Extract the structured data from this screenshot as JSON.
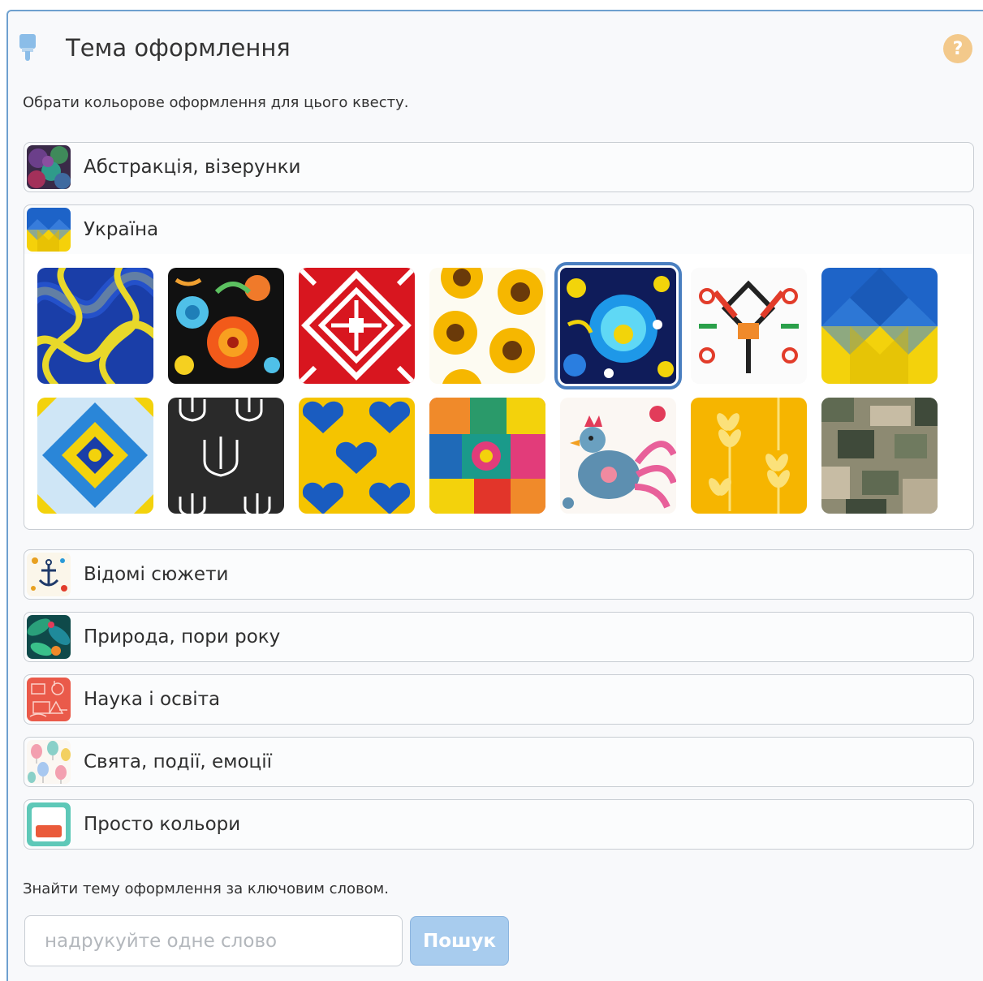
{
  "header": {
    "title": "Тема оформлення",
    "help_icon": "question-icon",
    "help_symbol": "?",
    "brush_icon": "paintbrush-icon"
  },
  "subtitle": "Обрати кольорове оформлення для цього квесту.",
  "categories": [
    {
      "label": "Абстракція, візерунки",
      "icon": "abstract-bokeh-thumb",
      "expanded": false
    },
    {
      "label": "Україна",
      "icon": "ukraine-flag-thumb",
      "expanded": true
    },
    {
      "label": "Відомі сюжети",
      "icon": "anchor-pattern-thumb",
      "expanded": false
    },
    {
      "label": "Природа, пори року",
      "icon": "tropical-leaves-thumb",
      "expanded": false
    },
    {
      "label": "Наука і освіта",
      "icon": "science-doodle-thumb",
      "expanded": false
    },
    {
      "label": "Свята, події, емоції",
      "icon": "balloons-thumb",
      "expanded": false
    },
    {
      "label": "Просто кольори",
      "icon": "plain-color-thumb",
      "expanded": false
    }
  ],
  "ukraine_themes": [
    {
      "name": "blue-yellow-waves",
      "selected": false
    },
    {
      "name": "petrykivka-flowers",
      "selected": false
    },
    {
      "name": "red-embroidery",
      "selected": false
    },
    {
      "name": "sunflowers",
      "selected": false
    },
    {
      "name": "blue-flower-folk",
      "selected": true
    },
    {
      "name": "cross-stitch-ornament",
      "selected": false
    },
    {
      "name": "blue-yellow-flag-geometric",
      "selected": false
    },
    {
      "name": "blue-mosaic-ornament",
      "selected": false
    },
    {
      "name": "trident-pattern",
      "selected": false
    },
    {
      "name": "blue-hearts",
      "selected": false
    },
    {
      "name": "patchwork-folk",
      "selected": false
    },
    {
      "name": "painted-rooster",
      "selected": false
    },
    {
      "name": "wheat-ears",
      "selected": false
    },
    {
      "name": "pixel-camouflage",
      "selected": false
    }
  ],
  "search": {
    "label": "Знайти тему оформлення за ключовим словом.",
    "placeholder": "надрукуйте одне слово",
    "button_label": "Пошук"
  },
  "colors": {
    "accent": "#4a7fc0",
    "panel_border": "#6ea0cf",
    "button_bg": "#a8ccee",
    "help_bg": "#f3c98b"
  }
}
